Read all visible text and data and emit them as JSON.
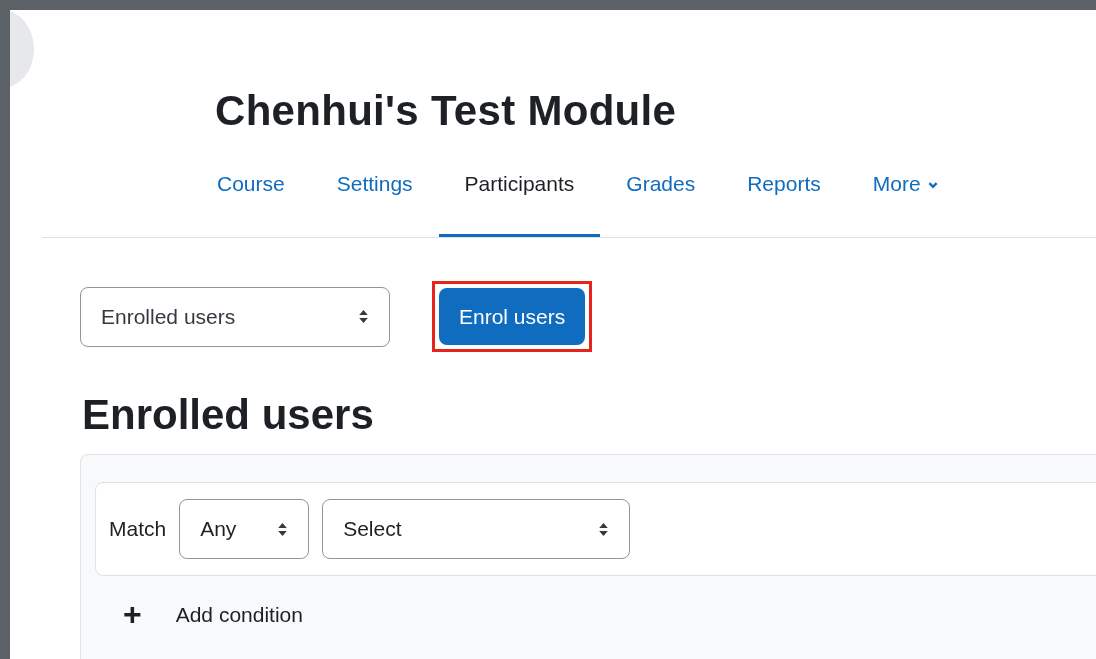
{
  "course_title": "Chenhui's Test Module",
  "tabs": [
    {
      "label": "Course",
      "selected": false
    },
    {
      "label": "Settings",
      "selected": false
    },
    {
      "label": "Participants",
      "selected": true
    },
    {
      "label": "Grades",
      "selected": false
    },
    {
      "label": "Reports",
      "selected": false
    },
    {
      "label": "More",
      "selected": false,
      "kind": "dropdown"
    }
  ],
  "view_select": {
    "value": "Enrolled users"
  },
  "enrol_button": {
    "label": "Enrol users",
    "highlighted": true
  },
  "heading": "Enrolled users",
  "filter": {
    "match_label": "Match",
    "match_select": {
      "value": "Any"
    },
    "type_select": {
      "value": "Select"
    },
    "add_condition": {
      "icon": "+",
      "label": "Add condition"
    }
  }
}
